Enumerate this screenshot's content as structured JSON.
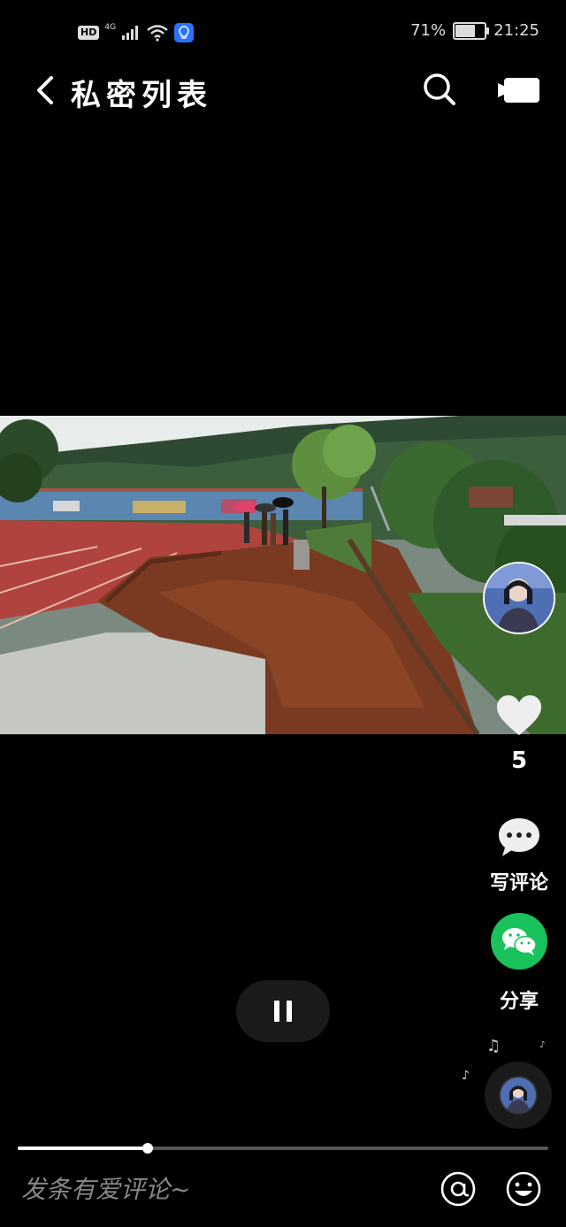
{
  "status_bar": {
    "hd": "HD",
    "network": "4G",
    "battery_percent": "71%",
    "battery_level": 0.71,
    "time": "21:25"
  },
  "header": {
    "title": "私密列表",
    "back_icon": "chevron-left-icon",
    "search_icon": "search-icon",
    "camera_icon": "video-camera-icon"
  },
  "video": {
    "playback_progress": 0.245,
    "pause_icon": "pause-icon"
  },
  "rail": {
    "like_icon": "heart-icon",
    "like_count": "5",
    "comment_icon": "comment-bubble-icon",
    "comment_label": "写评论",
    "share_icon": "wechat-icon",
    "share_label": "分享",
    "music_icon": "music-disc-icon"
  },
  "comment_bar": {
    "placeholder": "发条有爱评论~",
    "at_icon": "at-icon",
    "emoji_icon": "emoji-icon"
  },
  "colors": {
    "background": "#000000",
    "wechat_green": "#19c25a",
    "bulb_blue": "#2a73ff"
  }
}
